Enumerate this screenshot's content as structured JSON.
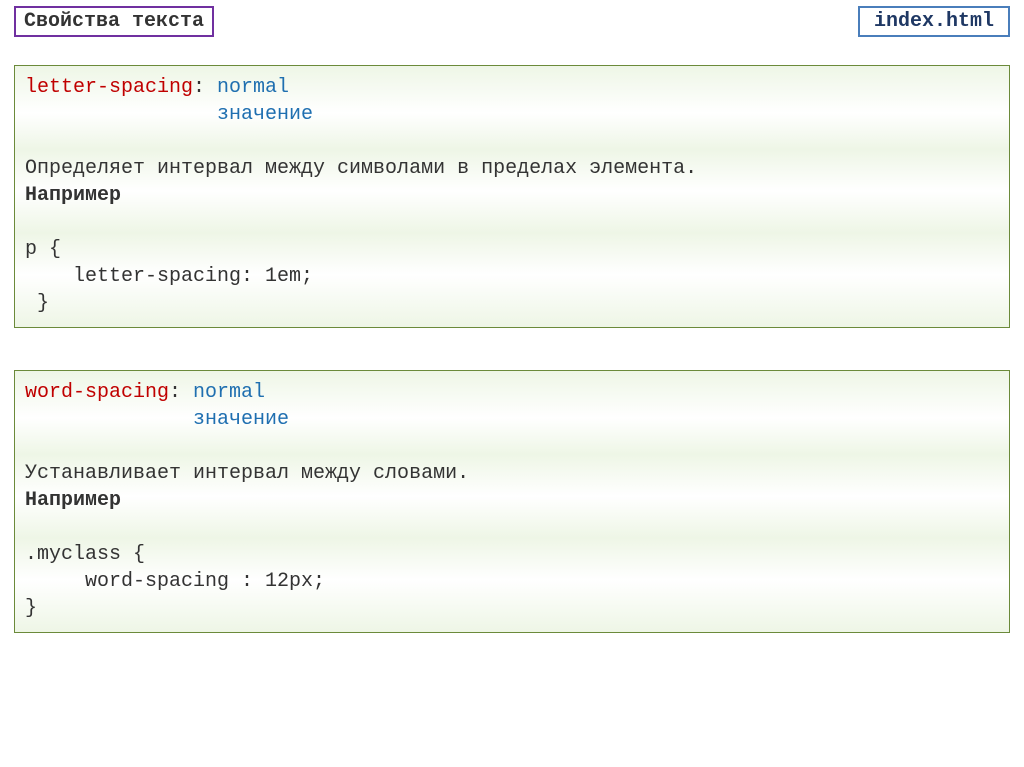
{
  "header": {
    "title": "Свойства текста",
    "filename": "index.html"
  },
  "panels": [
    {
      "property": "letter-spacing",
      "colon": ": ",
      "value1": "normal",
      "value2_indent": "                ",
      "value2": "значение",
      "blank1": "",
      "description": "Определяет интервал между символами в пределах элемента.",
      "example_label": "Например",
      "blank2": "",
      "code_line1": "p {",
      "code_line2": "    letter-spacing: 1em;",
      "code_line3": " }"
    },
    {
      "property": "word-spacing",
      "colon": ": ",
      "value1": "normal",
      "value2_indent": "              ",
      "value2": "значение",
      "blank1": "",
      "description": "Устанавливает интервал между словами.",
      "example_label": "Например",
      "blank2": "",
      "code_line1": ".myclass {",
      "code_line2": "     word-spacing : 12px;",
      "code_line3": "}"
    }
  ]
}
